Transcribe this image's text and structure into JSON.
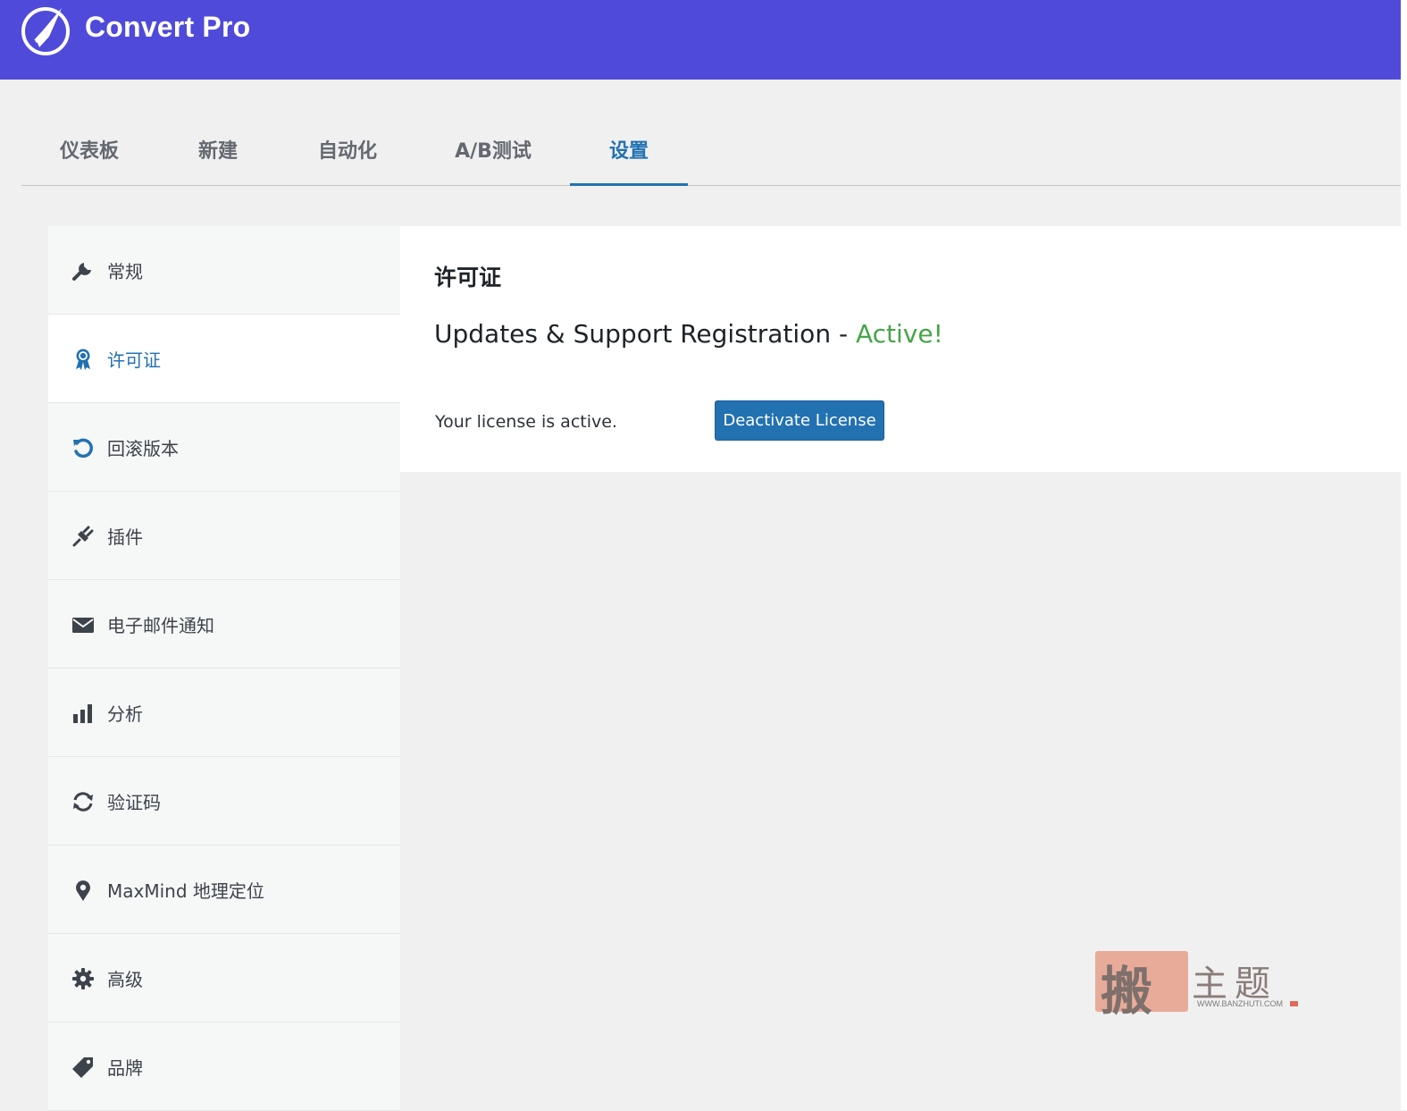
{
  "header": {
    "brand": "Convert Pro",
    "logo_icon": "rocket-logo-icon",
    "bg_color": "#4f4ad9"
  },
  "tabs": [
    {
      "label": "仪表板",
      "active": false
    },
    {
      "label": "新建",
      "active": false
    },
    {
      "label": "自动化",
      "active": false
    },
    {
      "label": "A/B测试",
      "active": false
    },
    {
      "label": "设置",
      "active": true
    }
  ],
  "sidebar": {
    "items": [
      {
        "label": "常规",
        "icon": "wrench-icon",
        "active": false
      },
      {
        "label": "许可证",
        "icon": "award-ribbon-icon",
        "active": true
      },
      {
        "label": "回滚版本",
        "icon": "rollback-icon",
        "active": false
      },
      {
        "label": "插件",
        "icon": "plugin-plug-icon",
        "active": false
      },
      {
        "label": "电子邮件通知",
        "icon": "envelope-icon",
        "active": false
      },
      {
        "label": "分析",
        "icon": "bar-chart-icon",
        "active": false
      },
      {
        "label": "验证码",
        "icon": "refresh-icon",
        "active": false
      },
      {
        "label": "MaxMind 地理定位",
        "icon": "location-pin-icon",
        "active": false
      },
      {
        "label": "高级",
        "icon": "gear-icon",
        "active": false
      },
      {
        "label": "品牌",
        "icon": "tag-icon",
        "active": false
      }
    ]
  },
  "license": {
    "title": "许可证",
    "heading_prefix": "Updates & Support Registration - ",
    "heading_status": "Active!",
    "status_text": "Your license is active.",
    "deactivate_label": "Deactivate License",
    "status_color": "#46a546",
    "button_color": "#2271b1"
  },
  "watermark": {
    "stamp_char": "搬",
    "text": "主题",
    "url": "WWW.BANZHUTI.COM"
  }
}
